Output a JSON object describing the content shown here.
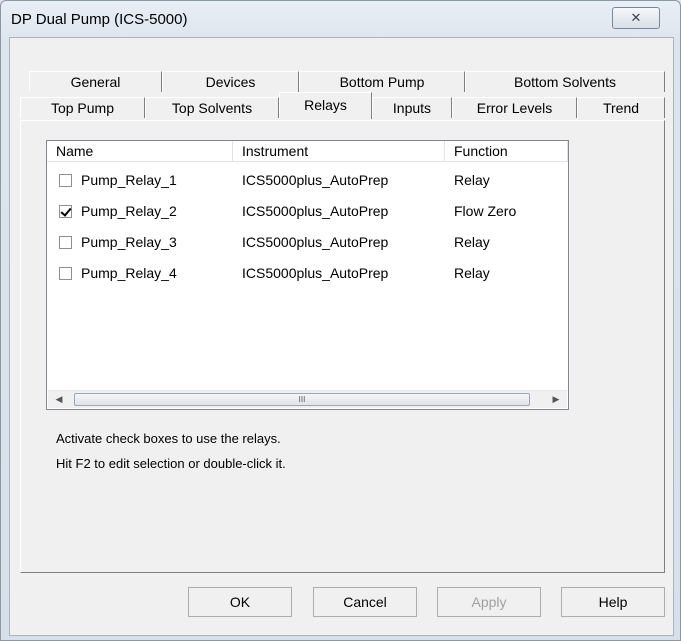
{
  "window": {
    "title": "DP Dual Pump (ICS-5000)",
    "close_glyph": "✕"
  },
  "tabs_row1": [
    "General",
    "Devices",
    "Bottom Pump",
    "Bottom Solvents"
  ],
  "tabs_row2": [
    "Top Pump",
    "Top Solvents",
    "Relays",
    "Inputs",
    "Error Levels",
    "Trend"
  ],
  "active_tab": "Relays",
  "list": {
    "columns": [
      "Name",
      "Instrument",
      "Function"
    ],
    "rows": [
      {
        "name": "Pump_Relay_1",
        "instrument": "ICS5000plus_AutoPrep",
        "function": "Relay",
        "checked": false
      },
      {
        "name": "Pump_Relay_2",
        "instrument": "ICS5000plus_AutoPrep",
        "function": "Flow Zero",
        "checked": true
      },
      {
        "name": "Pump_Relay_3",
        "instrument": "ICS5000plus_AutoPrep",
        "function": "Relay",
        "checked": false
      },
      {
        "name": "Pump_Relay_4",
        "instrument": "ICS5000plus_AutoPrep",
        "function": "Relay",
        "checked": false
      }
    ],
    "scroll_left": "◀",
    "scroll_right": "▶",
    "scroll_thumb_grip": "III"
  },
  "help_text": {
    "line1": "Activate check boxes to use the relays.",
    "line2": "Hit F2 to edit selection or double-click it."
  },
  "buttons": {
    "ok": "OK",
    "cancel": "Cancel",
    "apply": "Apply",
    "help": "Help"
  }
}
